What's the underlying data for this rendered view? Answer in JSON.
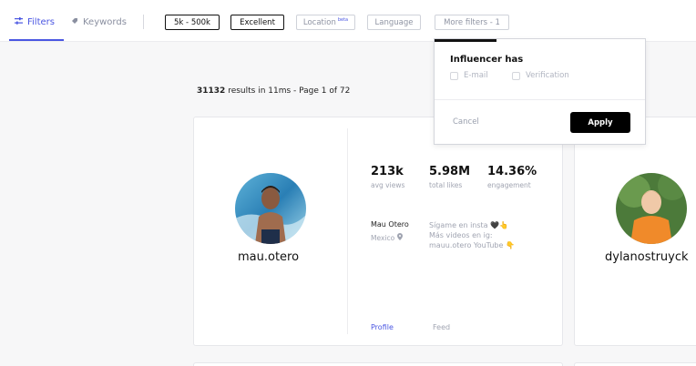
{
  "tabs": {
    "filters_label": "Filters",
    "keywords_label": "Keywords"
  },
  "filter_chips": {
    "followers": "5k - 500k",
    "quality": "Excellent",
    "location": "Location",
    "location_badge": "beta",
    "language": "Language",
    "more_filters": "More filters - 1"
  },
  "results": {
    "count": "31132",
    "text": "results in 11ms - Page 1 of 72"
  },
  "dropdown": {
    "title": "Influencer has",
    "options": [
      "E-mail",
      "Verification"
    ],
    "cancel_label": "Cancel",
    "apply_label": "Apply"
  },
  "influencers": [
    {
      "username": "mau.otero",
      "stats": [
        {
          "value": "213k",
          "label": "avg views"
        },
        {
          "value": "5.98M",
          "label": "total likes"
        },
        {
          "value": "14.36%",
          "label": "engagement"
        }
      ],
      "name": "Mau Otero",
      "location": "Mexico",
      "bio_lines": [
        "Sígame en insta 🖤👆",
        "Más videos en ig:",
        "mauu.otero YouTube 👇"
      ],
      "profile_label": "Profile",
      "feed_label": "Feed"
    },
    {
      "username": "dylanostruyck"
    }
  ],
  "colors": {
    "accent": "#4a56e2",
    "apply_bg": "#000000",
    "muted_text": "#a0a4b1"
  },
  "icons": {
    "filters": "sliders-icon",
    "keywords": "tag-icon",
    "location": "map-pin-icon"
  }
}
